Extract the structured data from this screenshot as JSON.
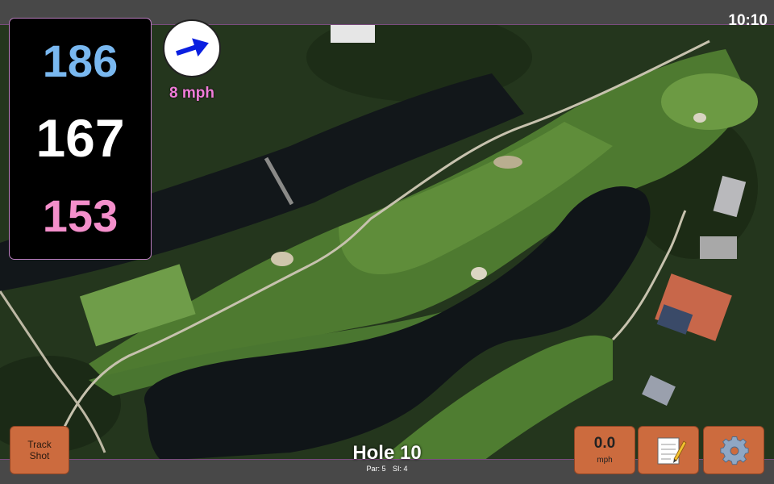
{
  "status": {
    "time": "10:10"
  },
  "distances": {
    "back": "186",
    "middle": "167",
    "front": "153"
  },
  "wind": {
    "speed": "8 mph",
    "icon": "wind-direction-arrow-icon"
  },
  "hole": {
    "title": "Hole 10",
    "par": "Par: 5",
    "stroke_index": "SI: 4"
  },
  "buttons": {
    "track_shot_line1": "Track",
    "track_shot_line2": "Shot",
    "speed_value": "0.0",
    "speed_unit": "mph",
    "notes_icon": "notepad-icon",
    "settings_icon": "gear-icon"
  },
  "colors": {
    "back": "#79b8f0",
    "middle": "#ffffff",
    "front": "#f48fcb",
    "button": "#cc6b3e",
    "wind_text": "#f07cd8"
  }
}
